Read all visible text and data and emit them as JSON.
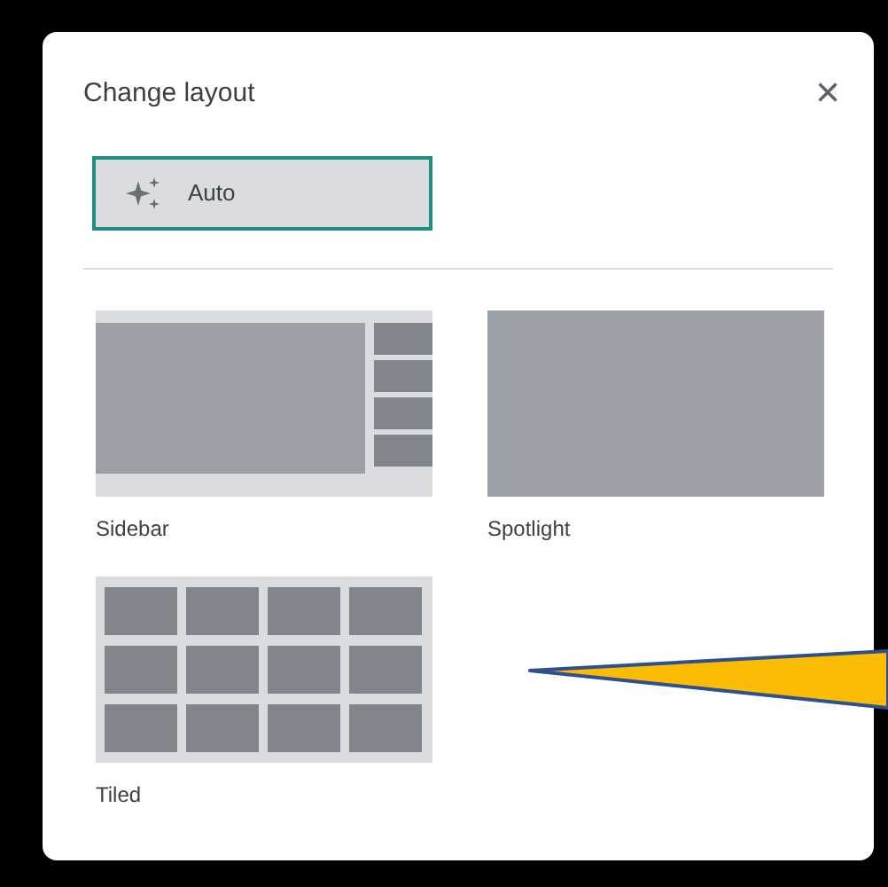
{
  "dialog": {
    "title": "Change layout",
    "close": "×"
  },
  "options": [
    {
      "kind": "auto",
      "label": "Auto",
      "selected": true
    },
    {
      "kind": "sidebar",
      "label": "Sidebar",
      "selected": false
    },
    {
      "kind": "spotlight",
      "label": "Spotlight",
      "selected": false
    },
    {
      "kind": "tiled",
      "label": "Tiled",
      "selected": false
    }
  ]
}
